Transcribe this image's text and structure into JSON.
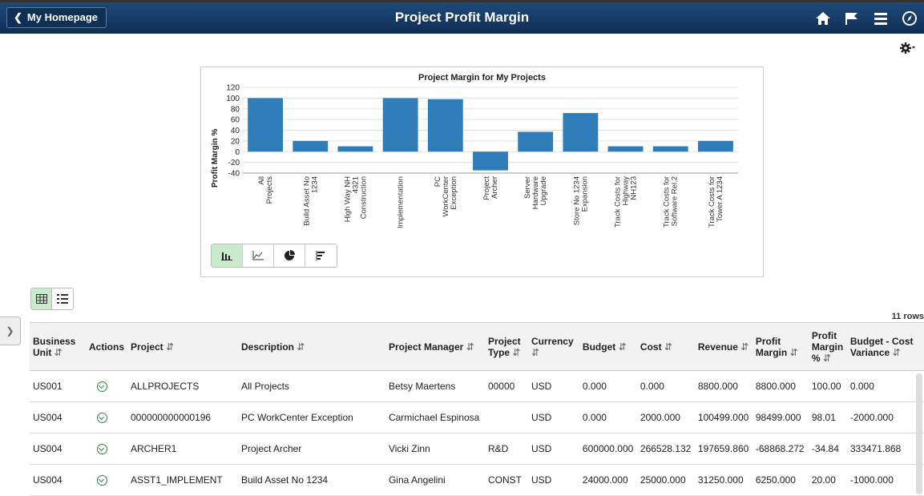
{
  "banner": {
    "home_label": "My Homepage",
    "title": "Project Profit Margin",
    "icons": [
      "home-icon",
      "flag-icon",
      "menu-icon",
      "compass-icon"
    ]
  },
  "chart_controls": {
    "types": [
      "bar-chart-icon",
      "line-chart-icon",
      "pie-chart-icon",
      "horizontal-bar-icon"
    ],
    "active_type": "bar"
  },
  "view_toggle": {
    "options": [
      "grid-view-icon",
      "list-view-icon"
    ],
    "active": "grid"
  },
  "chart_data": {
    "type": "bar",
    "title": "Project Margin for My Projects",
    "ylabel": "Profit Margin %",
    "xlabel": "",
    "ylim": [
      -40,
      120
    ],
    "yticks": [
      120,
      100,
      80,
      60,
      40,
      20,
      0,
      -20,
      -40
    ],
    "categories": [
      "All Projects",
      "Build Asset No 1234",
      "High Way NH 4321 Construction",
      "Implementation",
      "PC WorkCenter Exception",
      "Project Archer",
      "Server Hardware Upgrade",
      "Store No 1234 Expansion",
      "Track Costs for Highway NH123",
      "Track Costs for Software Rel.2",
      "Track Costs for Tower A 1234"
    ],
    "category_lines": [
      [
        "All",
        "Projects"
      ],
      [
        "Build Asset No",
        "1234"
      ],
      [
        "High Way NH",
        "4321",
        "Construction"
      ],
      [
        "Implementation"
      ],
      [
        "PC",
        "WorkCenter",
        "Exception"
      ],
      [
        "Project",
        "Archer"
      ],
      [
        "Server",
        "Hardware",
        "Upgrade"
      ],
      [
        "Store No 1234",
        "Expansion"
      ],
      [
        "Track Costs for",
        "Highway",
        "NH123"
      ],
      [
        "Track Costs for",
        "Software Rel.2"
      ],
      [
        "Track Costs for",
        "Tower A 1234"
      ]
    ],
    "values": [
      100,
      20,
      10,
      100,
      98,
      -35,
      37,
      72,
      10,
      10,
      20
    ],
    "bar_color": "#2e7db8",
    "grid": true
  },
  "table": {
    "row_count": "11 rows",
    "columns": [
      "Business Unit",
      "Actions",
      "Project",
      "Description",
      "Project Manager",
      "Project Type",
      "Currency",
      "Budget",
      "Cost",
      "Revenue",
      "Profit Margin",
      "Profit Margin %",
      "Budget - Cost Variance"
    ],
    "rows": [
      [
        "US001",
        "",
        "ALLPROJECTS",
        "All Projects",
        "Betsy Maertens",
        "00000",
        "USD",
        "0.000",
        "0.000",
        "8800.000",
        "8800.000",
        "100.00",
        "0.000"
      ],
      [
        "US004",
        "",
        "000000000000196",
        "PC WorkCenter Exception",
        "Carmichael Espinosa",
        "",
        "USD",
        "0.000",
        "2000.000",
        "100499.000",
        "98499.000",
        "98.01",
        "-2000.000"
      ],
      [
        "US004",
        "",
        "ARCHER1",
        "Project Archer",
        "Vicki Zinn",
        "R&D",
        "USD",
        "600000.000",
        "266528.132",
        "197659.860",
        "-68868.272",
        "-34.84",
        "333471.868"
      ],
      [
        "US004",
        "",
        "ASST1_IMPLEMENT",
        "Build Asset No 1234",
        "Gina Angelini",
        "CONST",
        "USD",
        "24000.000",
        "25000.000",
        "31250.000",
        "6250.000",
        "20.00",
        "-1000.000"
      ]
    ]
  }
}
